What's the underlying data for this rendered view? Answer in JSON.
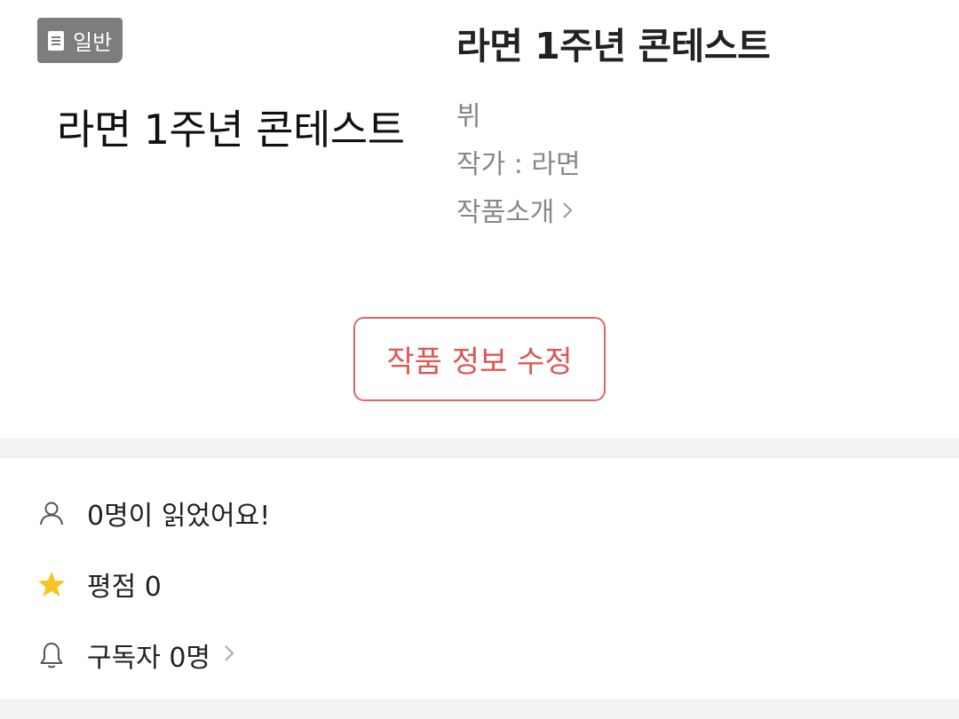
{
  "cover": {
    "badge_label": "일반",
    "title": "라면 1주년 콘테스트"
  },
  "info": {
    "title": "라면 1주년 콘테스트",
    "genre": "뷔",
    "author": "작가 : 라면",
    "intro_link": "작품소개"
  },
  "actions": {
    "edit_label": "작품 정보 수정"
  },
  "stats": {
    "readers": "0명이 읽었어요!",
    "rating": "평점 0",
    "subscribers": "구독자 0명"
  },
  "colors": {
    "accent": "#e06666",
    "star": "#f7c325",
    "badge_bg": "#7d7d7d",
    "divider": "#f1f2f4"
  },
  "icons": {
    "badge": "document-icon",
    "readers": "person-icon",
    "rating": "star-icon",
    "subscribers": "bell-icon",
    "link": "chevron-right-icon"
  }
}
